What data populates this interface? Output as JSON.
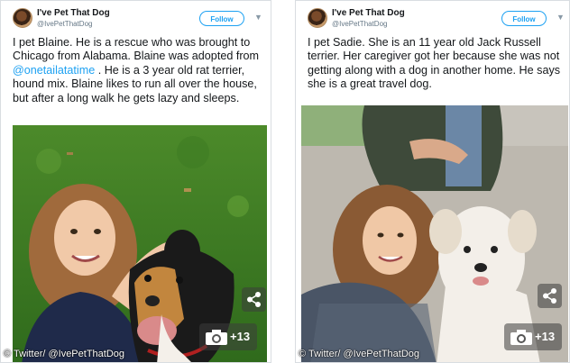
{
  "tweets": [
    {
      "author_name": "I've Pet That Dog",
      "author_handle": "@IvePetThatDog",
      "follow_label": "Follow",
      "menu_icon": "chevron-down-icon",
      "text_part1": "I pet Blaine. He is a rescue who was brought to Chicago from Alabama. Blaine was adopted from ",
      "mention": "@onetailatatime",
      "text_part2": " . He is a 3 year old rat terrier, hound mix. Blaine likes to run all over the house, but after a long walk he gets lazy and sleeps.",
      "photo_icon": "camera-icon",
      "photo_count": "+13",
      "share_icon": "share-icon",
      "credit": "© Twitter/ @IvePetThatDog"
    },
    {
      "author_name": "I've Pet That Dog",
      "author_handle": "@IvePetThatDog",
      "follow_label": "Follow",
      "menu_icon": "chevron-down-icon",
      "text": "I pet Sadie. She is an 11 year old Jack Russell terrier. Her caregiver got her because she was not getting along with a dog in another home. He says she is a great travel dog.",
      "photo_icon": "camera-icon",
      "photo_count": "+13",
      "share_icon": "share-icon",
      "credit": "© Twitter/ @IvePetThatDog"
    }
  ],
  "colors": {
    "link": "#1da1f2",
    "text": "#14171a",
    "muted": "#657786"
  }
}
